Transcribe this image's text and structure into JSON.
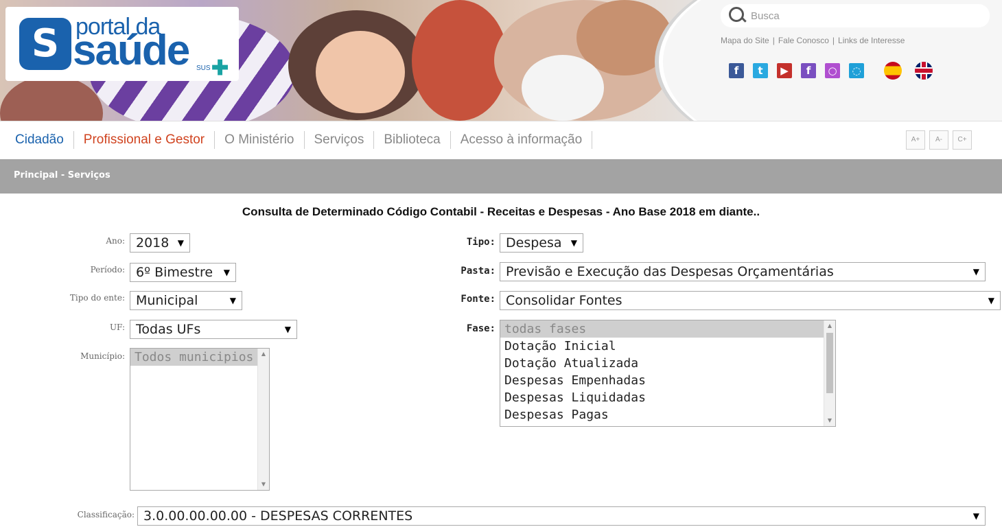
{
  "header": {
    "logo_portal": "portal da",
    "logo_saude": "saúde",
    "logo_sus": "SUS",
    "search_placeholder": "Busca",
    "top_links": [
      "Mapa do Site",
      "Fale Conosco",
      "Links de Interesse"
    ],
    "social": [
      {
        "name": "facebook-icon",
        "glyph": "f",
        "color": "#3b5998"
      },
      {
        "name": "twitter-icon",
        "glyph": "t",
        "color": "#2aa9e0"
      },
      {
        "name": "youtube-icon",
        "glyph": "▶",
        "color": "#c4302b"
      },
      {
        "name": "flickr-icon",
        "glyph": "f",
        "color": "#7a4fc0"
      },
      {
        "name": "instagram-icon",
        "glyph": "○",
        "color": "#b04fd0"
      },
      {
        "name": "chat-icon",
        "glyph": "◌",
        "color": "#1fa0d8"
      }
    ],
    "languages": [
      "spanish-flag-icon",
      "english-flag-icon"
    ]
  },
  "nav": {
    "items": [
      "Cidadão",
      "Profissional e Gestor",
      "O Ministério",
      "Serviços",
      "Biblioteca",
      "Acesso à informação"
    ],
    "font_buttons": [
      "A+",
      "A-",
      "C+"
    ]
  },
  "breadcrumb": "Principal - Serviços",
  "title": "Consulta de Determinado Código Contabil - Receitas e Despesas - Ano Base 2018 em diante..",
  "form": {
    "ano": {
      "label": "Ano:",
      "value": "2018"
    },
    "periodo": {
      "label": "Período:",
      "value": "6º Bimestre"
    },
    "tipo_ente": {
      "label": "Tipo do ente:",
      "value": "Municipal"
    },
    "uf": {
      "label": "UF:",
      "value": "Todas UFs"
    },
    "municipio": {
      "label": "Município:",
      "options": [
        "Todos municipios"
      ]
    },
    "tipo": {
      "label": "Tipo:",
      "value": "Despesa"
    },
    "pasta": {
      "label": "Pasta:",
      "value": "Previsão e Execução das Despesas Orçamentárias"
    },
    "fonte": {
      "label": "Fonte:",
      "value": "Consolidar Fontes"
    },
    "fase": {
      "label": "Fase:",
      "options": [
        "todas fases",
        "Dotação Inicial",
        "Dotação Atualizada",
        "Despesas Empenhadas",
        "Despesas Liquidadas",
        "Despesas Pagas"
      ]
    },
    "classificacao": {
      "label": "Classificação:",
      "value": "3.0.00.00.00.00 - DESPESAS CORRENTES"
    }
  },
  "colors": {
    "brand_blue": "#1a62ad",
    "active_nav": "#d0431f",
    "breadcrumb_bar": "#a3a3a3"
  }
}
